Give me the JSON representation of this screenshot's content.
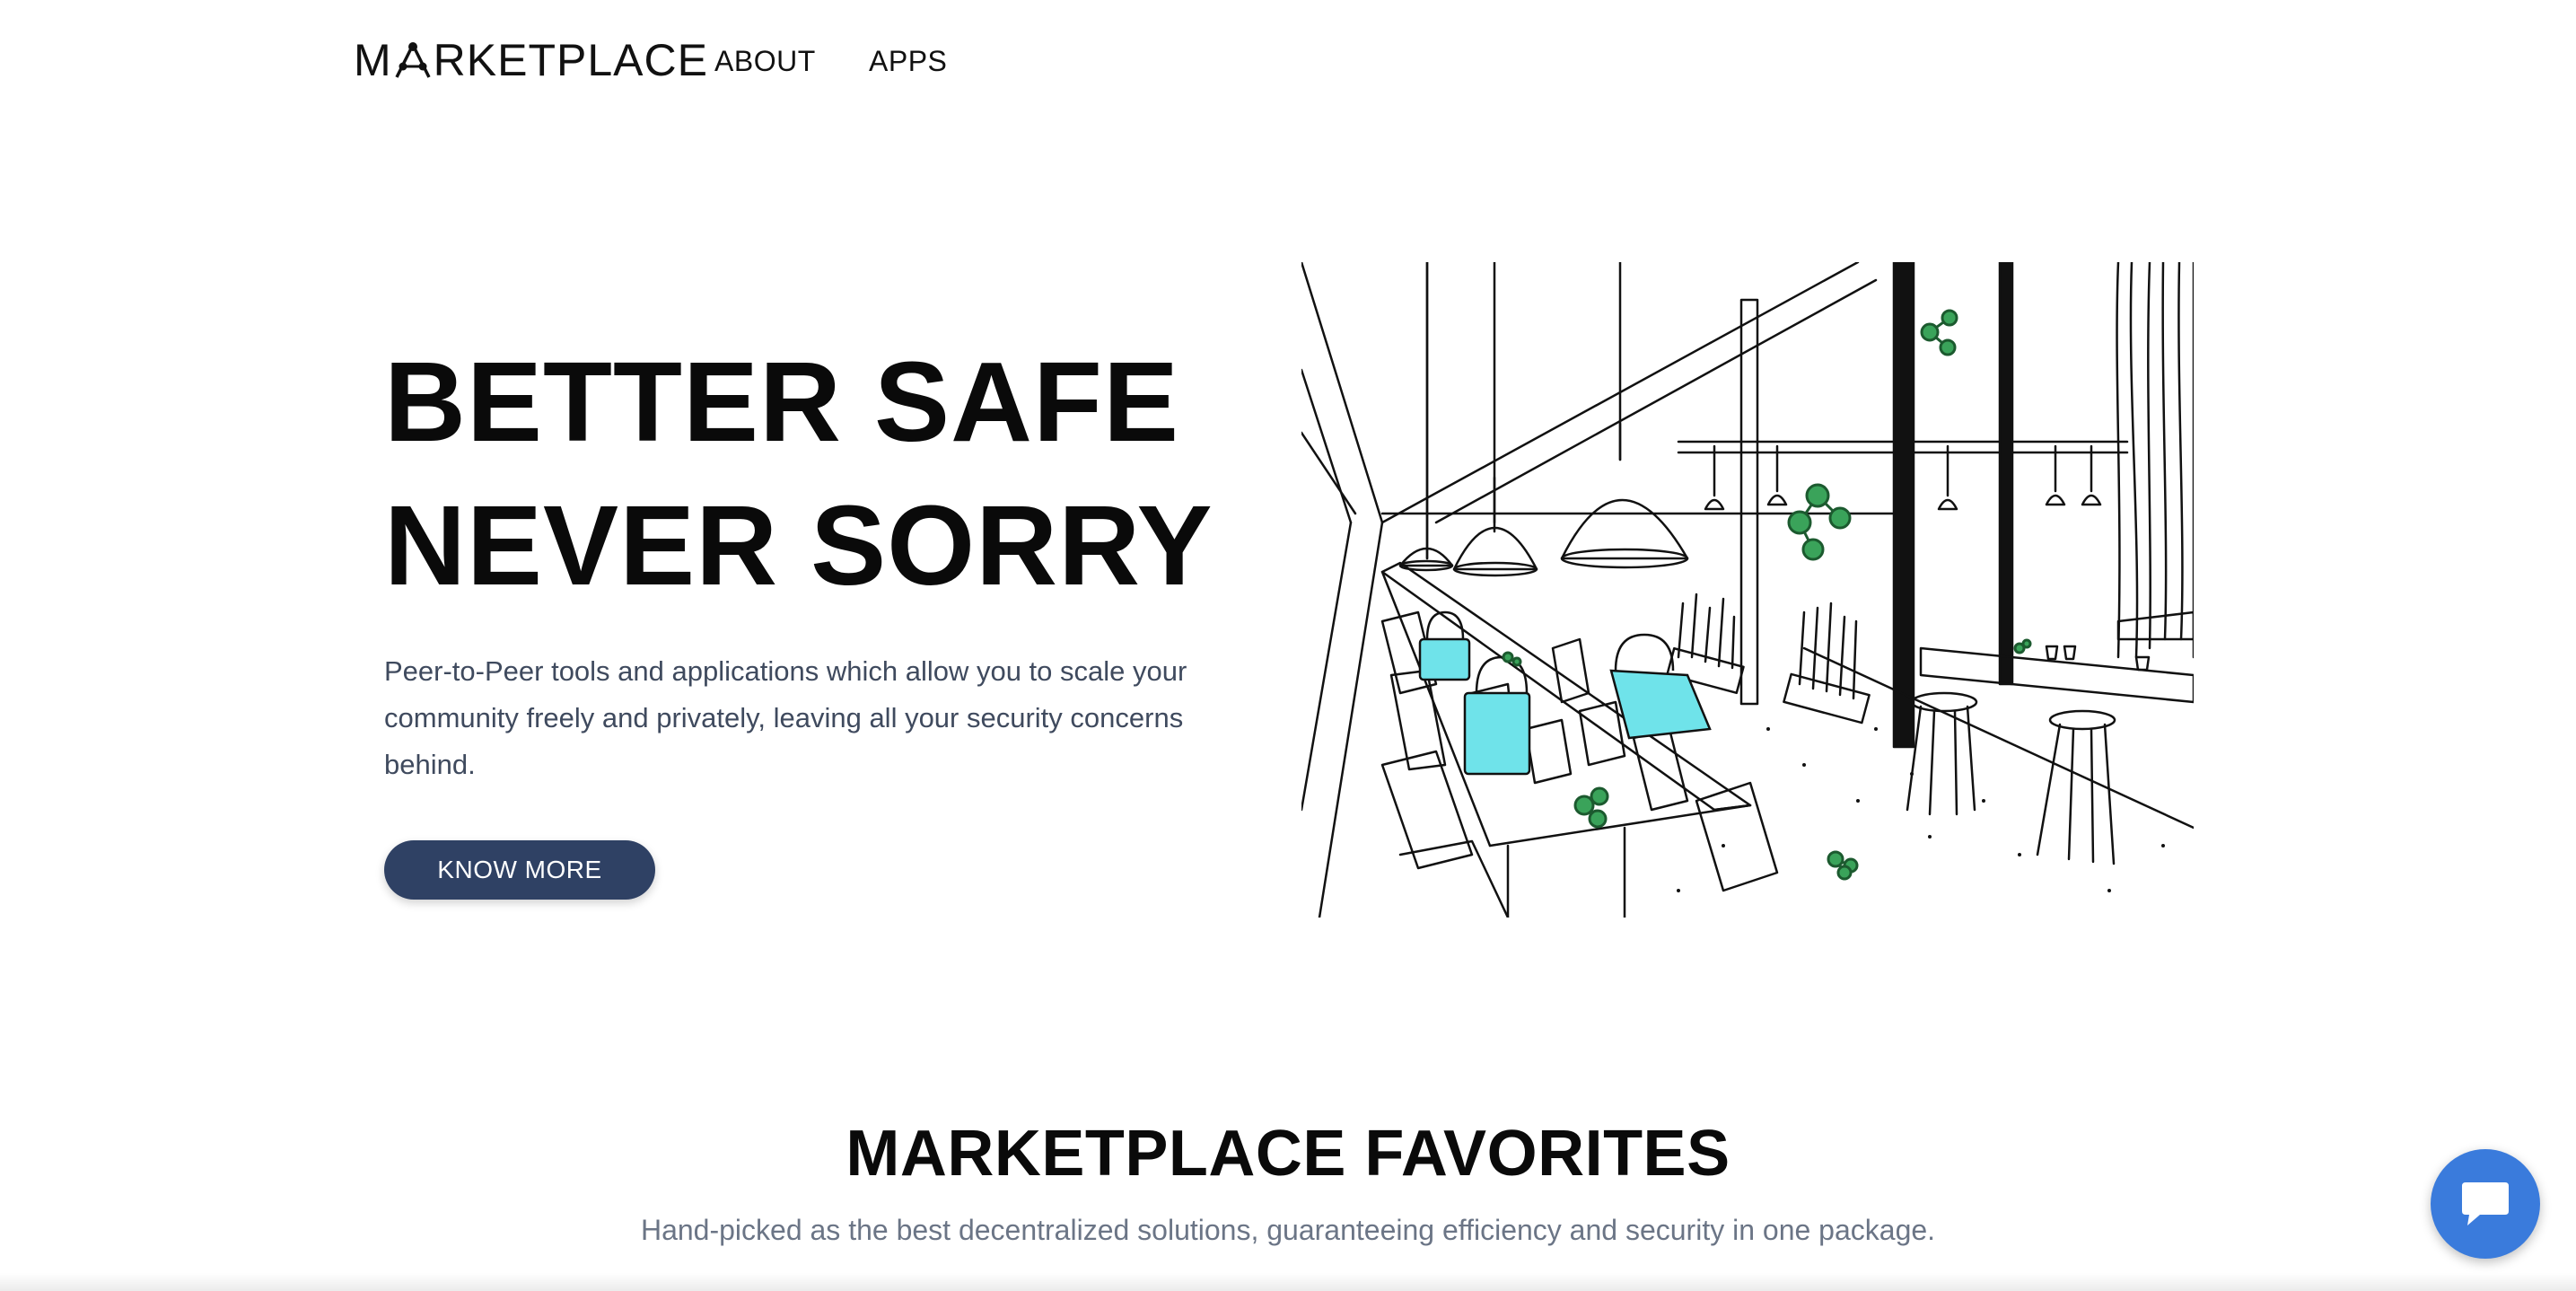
{
  "nav": {
    "logo_text_before": "M",
    "logo_text_after": "RKETPLACE",
    "links": [
      {
        "label": "ABOUT"
      },
      {
        "label": "APPS"
      }
    ]
  },
  "hero": {
    "title_line1": "BETTER SAFE",
    "title_line2": "NEVER SORRY",
    "description": "Peer-to-Peer tools and applications which allow you to scale your community freely and privately, leaving all your security concerns behind.",
    "cta_label": "KNOW MORE",
    "illustration_icon": "office-illustration"
  },
  "favorites": {
    "title": "MARKETPLACE FAVORITES",
    "subtitle": "Hand-picked as the best decentralized solutions, guaranteeing efficiency and security in one package."
  },
  "chat": {
    "icon": "chat-bubble-icon"
  },
  "colors": {
    "primary_button": "#2f4164",
    "chat_button": "#3a7bdc",
    "lock_cyan": "#6fe3ea",
    "node_green": "#3aa35a",
    "body_text": "#3f4a5e",
    "muted_text": "#6b7586"
  }
}
